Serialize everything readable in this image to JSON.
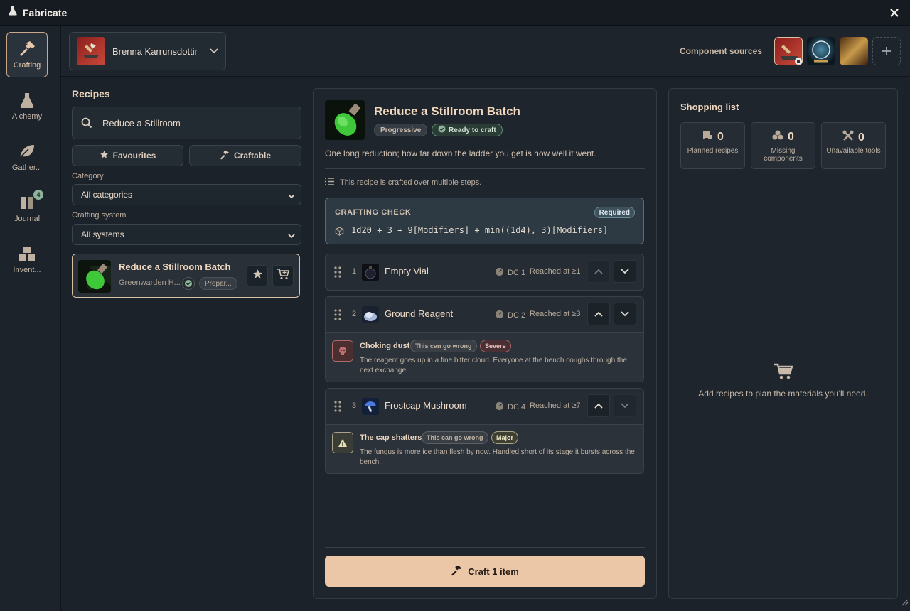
{
  "window": {
    "title": "Fabricate"
  },
  "nav": {
    "items": [
      {
        "label": "Crafting",
        "icon": "hammer-icon"
      },
      {
        "label": "Alchemy",
        "icon": "flask-icon"
      },
      {
        "label": "Gather...",
        "icon": "leaf-icon"
      },
      {
        "label": "Journal",
        "icon": "book-icon",
        "badge": "4"
      },
      {
        "label": "Invent...",
        "icon": "boxes-icon"
      }
    ]
  },
  "actor": {
    "name": "Brenna Karrunsdottir"
  },
  "sources": {
    "label": "Component sources"
  },
  "recipes": {
    "heading": "Recipes",
    "search_value": "Reduce a Stillroom",
    "favourites_label": "Favourites",
    "craftable_label": "Craftable",
    "category_label": "Category",
    "category_value": "All categories",
    "system_label": "Crafting system",
    "system_value": "All systems",
    "list": [
      {
        "name": "Reduce a Stillroom Batch",
        "source": "Greenwarden H...",
        "tag": "Prepar..."
      }
    ]
  },
  "detail": {
    "title": "Reduce a Stillroom Batch",
    "tag_progressive": "Progressive",
    "tag_ready": "Ready to craft",
    "description": "One long reduction; how far down the ladder you get is how well it went.",
    "multistep_note": "This recipe is crafted over multiple steps.",
    "check": {
      "title": "CRAFTING CHECK",
      "required": "Required",
      "formula": "1d20 + 3 + 9[Modifiers] + min((1d4), 3)[Modifiers]"
    },
    "steps": [
      {
        "num": "1",
        "name": "Empty Vial",
        "dc": "DC 1",
        "reached": "Reached at ≥1"
      },
      {
        "num": "2",
        "name": "Ground Reagent",
        "dc": "DC 2",
        "reached": "Reached at ≥3",
        "risk": {
          "title": "Choking dust",
          "tag": "This can go wrong",
          "severity": "Severe",
          "text": "The reagent goes up in a fine bitter cloud. Everyone at the bench coughs through the next exchange."
        }
      },
      {
        "num": "3",
        "name": "Frostcap Mushroom",
        "dc": "DC 4",
        "reached": "Reached at ≥7",
        "risk": {
          "title": "The cap shatters",
          "tag": "This can go wrong",
          "severity": "Major",
          "text": "The fungus is more ice than flesh by now. Handled short of its stage it bursts across the bench."
        }
      }
    ],
    "craft_label": "Craft 1 item"
  },
  "shopping": {
    "title": "Shopping list",
    "stats": [
      {
        "value": "0",
        "label": "Planned recipes"
      },
      {
        "value": "0",
        "label": "Missing components"
      },
      {
        "value": "0",
        "label": "Unavailable tools"
      }
    ],
    "empty_text": "Add recipes to plan the materials you'll need."
  },
  "colors": {
    "accent": "#ebc7a8",
    "success": "#8db39a",
    "severe": "#c07070",
    "major": "#e8dcb0"
  }
}
